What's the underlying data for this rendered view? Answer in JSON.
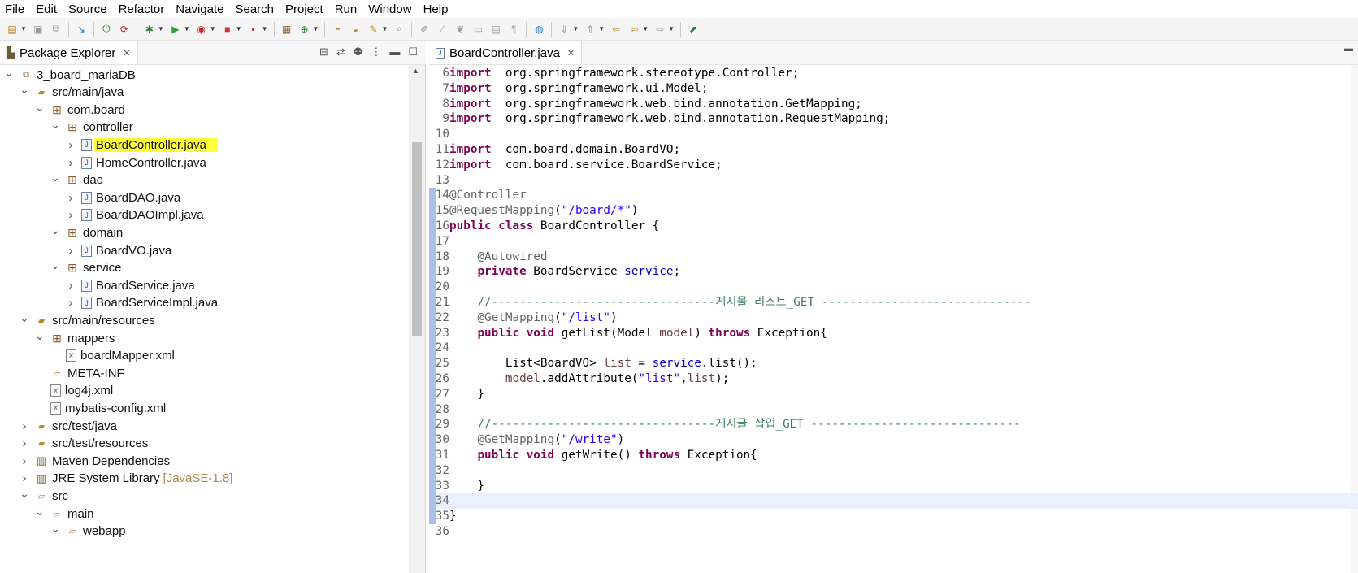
{
  "menu": [
    "File",
    "Edit",
    "Source",
    "Refactor",
    "Navigate",
    "Search",
    "Project",
    "Run",
    "Window",
    "Help"
  ],
  "toolbar_icons": [
    "new-icon",
    "save-icon",
    "save-all-icon",
    "skip-breakpoints-icon",
    "debug-icon",
    "run-icon",
    "coverage-icon",
    "external-tools-icon",
    "new-java-project-icon",
    "new-package-icon",
    "new-class-icon",
    "open-type-icon",
    "search-icon",
    "annotation-nav-icon",
    "back-icon",
    "forward-icon",
    "pin-icon"
  ],
  "package_explorer": {
    "tab_label": "Package Explorer",
    "tree": [
      {
        "label": "3_board_mariaDB",
        "icon": "project-icon",
        "level": 0,
        "expanded": true
      },
      {
        "label": "src/main/java",
        "icon": "source-folder-icon",
        "level": 1,
        "expanded": true
      },
      {
        "label": "com.board",
        "icon": "package-icon",
        "level": 2,
        "expanded": true
      },
      {
        "label": "controller",
        "icon": "package-icon",
        "level": 3,
        "expanded": true
      },
      {
        "label": "BoardController.java",
        "icon": "java-file-icon",
        "level": 4,
        "expanded": false,
        "highlighted": true
      },
      {
        "label": "HomeController.java",
        "icon": "java-file-icon",
        "level": 4,
        "expanded": false
      },
      {
        "label": "dao",
        "icon": "package-icon",
        "level": 3,
        "expanded": true
      },
      {
        "label": "BoardDAO.java",
        "icon": "java-file-icon",
        "level": 4,
        "expanded": false
      },
      {
        "label": "BoardDAOImpl.java",
        "icon": "java-file-icon",
        "level": 4,
        "expanded": false
      },
      {
        "label": "domain",
        "icon": "package-icon",
        "level": 3,
        "expanded": true
      },
      {
        "label": "BoardVO.java",
        "icon": "java-file-icon",
        "level": 4,
        "expanded": false
      },
      {
        "label": "service",
        "icon": "package-icon",
        "level": 3,
        "expanded": true
      },
      {
        "label": "BoardService.java",
        "icon": "java-file-icon",
        "level": 4,
        "expanded": false
      },
      {
        "label": "BoardServiceImpl.java",
        "icon": "java-file-icon",
        "level": 4,
        "expanded": false
      },
      {
        "label": "src/main/resources",
        "icon": "source-folder-icon",
        "level": 1,
        "expanded": true
      },
      {
        "label": "mappers",
        "icon": "package-icon",
        "level": 2,
        "expanded": true
      },
      {
        "label": "boardMapper.xml",
        "icon": "xml-file-icon",
        "level": 3,
        "leaf": true
      },
      {
        "label": "META-INF",
        "icon": "folder-icon",
        "level": 2,
        "leaf": true
      },
      {
        "label": "log4j.xml",
        "icon": "xml-file-icon",
        "level": 2,
        "leaf": true
      },
      {
        "label": "mybatis-config.xml",
        "icon": "xml-file-icon",
        "level": 2,
        "leaf": true
      },
      {
        "label": "src/test/java",
        "icon": "source-folder-icon",
        "level": 1,
        "expanded": false
      },
      {
        "label": "src/test/resources",
        "icon": "source-folder-icon",
        "level": 1,
        "expanded": false
      },
      {
        "label": "Maven Dependencies",
        "icon": "library-icon",
        "level": 1,
        "expanded": false
      },
      {
        "label": "JRE System Library",
        "icon": "library-icon",
        "level": 1,
        "expanded": false,
        "decoration": "[JavaSE-1.8]"
      },
      {
        "label": "src",
        "icon": "folder-icon",
        "level": 1,
        "expanded": true
      },
      {
        "label": "main",
        "icon": "folder-icon",
        "level": 2,
        "expanded": true
      },
      {
        "label": "webapp",
        "icon": "folder-icon",
        "level": 3,
        "expanded": true
      }
    ]
  },
  "editor": {
    "tab_label": "BoardController.java",
    "lines": [
      {
        "n": "6",
        "tokens": [
          [
            "kw",
            "import"
          ],
          [
            "",
            "  org.springframework.stereotype.Controller;"
          ]
        ]
      },
      {
        "n": "7",
        "tokens": [
          [
            "kw",
            "import"
          ],
          [
            "",
            "  org.springframework.ui.Model;"
          ]
        ]
      },
      {
        "n": "8",
        "tokens": [
          [
            "kw",
            "import"
          ],
          [
            "",
            "  org.springframework.web.bind.annotation.GetMapping;"
          ]
        ]
      },
      {
        "n": "9",
        "tokens": [
          [
            "kw",
            "import"
          ],
          [
            "",
            "  org.springframework.web.bind.annotation.RequestMapping;"
          ]
        ]
      },
      {
        "n": "10",
        "tokens": []
      },
      {
        "n": "11",
        "tokens": [
          [
            "kw",
            "import"
          ],
          [
            "",
            "  com.board.domain.BoardVO;"
          ]
        ]
      },
      {
        "n": "12",
        "tokens": [
          [
            "kw",
            "import"
          ],
          [
            "",
            "  com.board.service.BoardService;"
          ]
        ]
      },
      {
        "n": "13",
        "tokens": []
      },
      {
        "n": "14",
        "gutter": true,
        "tokens": [
          [
            "an",
            "@Controller"
          ]
        ]
      },
      {
        "n": "15",
        "gutter": true,
        "tokens": [
          [
            "an",
            "@RequestMapping"
          ],
          [
            "",
            "("
          ],
          [
            "st",
            "\"/board/*\""
          ],
          [
            "",
            ")"
          ]
        ]
      },
      {
        "n": "16",
        "gutter": true,
        "tokens": [
          [
            "kw",
            "public"
          ],
          [
            "",
            " "
          ],
          [
            "kw",
            "class"
          ],
          [
            "",
            " BoardController {"
          ]
        ]
      },
      {
        "n": "17",
        "gutter": true,
        "tokens": []
      },
      {
        "n": "18",
        "gutter": true,
        "tokens": [
          [
            "",
            "    "
          ],
          [
            "an",
            "@Autowired"
          ]
        ]
      },
      {
        "n": "19",
        "gutter": true,
        "tokens": [
          [
            "",
            "    "
          ],
          [
            "kw",
            "private"
          ],
          [
            "",
            " BoardService "
          ],
          [
            "fd",
            "service"
          ],
          [
            "",
            ";"
          ]
        ]
      },
      {
        "n": "20",
        "gutter": true,
        "tokens": []
      },
      {
        "n": "21",
        "gutter": true,
        "tokens": [
          [
            "",
            "    "
          ],
          [
            "cm",
            "//--------------------------------게시물 리스트_GET ------------------------------"
          ]
        ]
      },
      {
        "n": "22",
        "gutter": true,
        "tokens": [
          [
            "",
            "    "
          ],
          [
            "an",
            "@GetMapping"
          ],
          [
            "",
            "("
          ],
          [
            "st",
            "\"/list\""
          ],
          [
            "",
            ")"
          ]
        ]
      },
      {
        "n": "23",
        "gutter": true,
        "tokens": [
          [
            "",
            "    "
          ],
          [
            "kw",
            "public"
          ],
          [
            "",
            " "
          ],
          [
            "kw",
            "void"
          ],
          [
            "",
            " getList(Model "
          ],
          [
            "lv",
            "model"
          ],
          [
            "",
            ") "
          ],
          [
            "kw",
            "throws"
          ],
          [
            "",
            " Exception{"
          ]
        ]
      },
      {
        "n": "24",
        "gutter": true,
        "tokens": []
      },
      {
        "n": "25",
        "gutter": true,
        "tokens": [
          [
            "",
            "        List<BoardVO> "
          ],
          [
            "lv",
            "list"
          ],
          [
            "",
            " = "
          ],
          [
            "fd",
            "service"
          ],
          [
            "",
            ".list();"
          ]
        ]
      },
      {
        "n": "26",
        "gutter": true,
        "tokens": [
          [
            "",
            "        "
          ],
          [
            "lv",
            "model"
          ],
          [
            "",
            ".addAttribute("
          ],
          [
            "st",
            "\"list\""
          ],
          [
            "",
            ","
          ],
          [
            "lv",
            "list"
          ],
          [
            "",
            ");"
          ]
        ]
      },
      {
        "n": "27",
        "gutter": true,
        "tokens": [
          [
            "",
            "    }"
          ]
        ]
      },
      {
        "n": "28",
        "gutter": true,
        "tokens": []
      },
      {
        "n": "29",
        "gutter": true,
        "tokens": [
          [
            "",
            "    "
          ],
          [
            "cm",
            "//--------------------------------게시글 삽입_GET ------------------------------"
          ]
        ]
      },
      {
        "n": "30",
        "gutter": true,
        "tokens": [
          [
            "",
            "    "
          ],
          [
            "an",
            "@GetMapping"
          ],
          [
            "",
            "("
          ],
          [
            "st",
            "\"/write\""
          ],
          [
            "",
            ")"
          ]
        ]
      },
      {
        "n": "31",
        "gutter": true,
        "tokens": [
          [
            "",
            "    "
          ],
          [
            "kw",
            "public"
          ],
          [
            "",
            " "
          ],
          [
            "kw",
            "void"
          ],
          [
            "",
            " getWrite() "
          ],
          [
            "kw",
            "throws"
          ],
          [
            "",
            " Exception{"
          ]
        ]
      },
      {
        "n": "32",
        "gutter": true,
        "tokens": []
      },
      {
        "n": "33",
        "gutter": true,
        "tokens": [
          [
            "",
            "    }"
          ]
        ]
      },
      {
        "n": "34",
        "gutter": true,
        "current": true,
        "tokens": []
      },
      {
        "n": "35",
        "gutter": true,
        "tokens": [
          [
            "",
            "}"
          ]
        ]
      },
      {
        "n": "36",
        "tokens": []
      }
    ]
  },
  "colors": {
    "keyword": "#7f0055",
    "annotation": "#646464",
    "string": "#2a00ff",
    "field": "#0000c0",
    "comment": "#3f7f5f",
    "local": "#6a3e3e",
    "highlight": "#ffff3a",
    "gutter": "#a9c2e6"
  }
}
